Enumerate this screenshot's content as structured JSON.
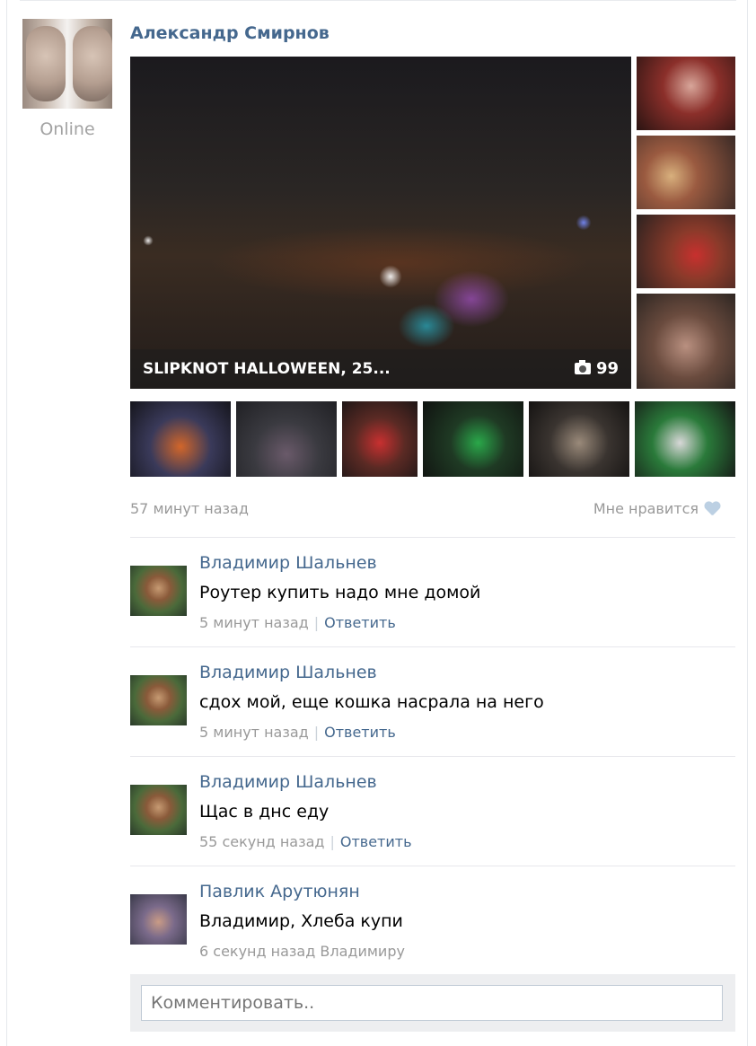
{
  "post": {
    "author": "Александр Смирнов",
    "status": "Online",
    "album": {
      "title": "SLIPKNOT HALLOWEEN, 25...",
      "photo_count": "99"
    },
    "time": "57 минут назад",
    "like_label": "Мне нравится"
  },
  "comments": [
    {
      "author": "Владимир Шальнев",
      "text": "Роутер купить надо мне домой",
      "time": "5 минут назад",
      "reply": "Ответить"
    },
    {
      "author": "Владимир Шальнев",
      "text": "сдох мой, еще кошка насрала на него",
      "time": "5 минут назад",
      "reply": "Ответить"
    },
    {
      "author": "Владимир Шальнев",
      "text": "Щас в днс еду",
      "time": "55 секунд назад",
      "reply": "Ответить"
    },
    {
      "author": "Павлик Арутюнян",
      "text": "Владимир, Хлеба купи",
      "time": "6 секунд назад Владимиру"
    }
  ],
  "comment_input": {
    "placeholder": "Комментировать.."
  },
  "colors": {
    "link": "#45688e",
    "meta": "#999999",
    "heart": "#bcd0e3"
  }
}
